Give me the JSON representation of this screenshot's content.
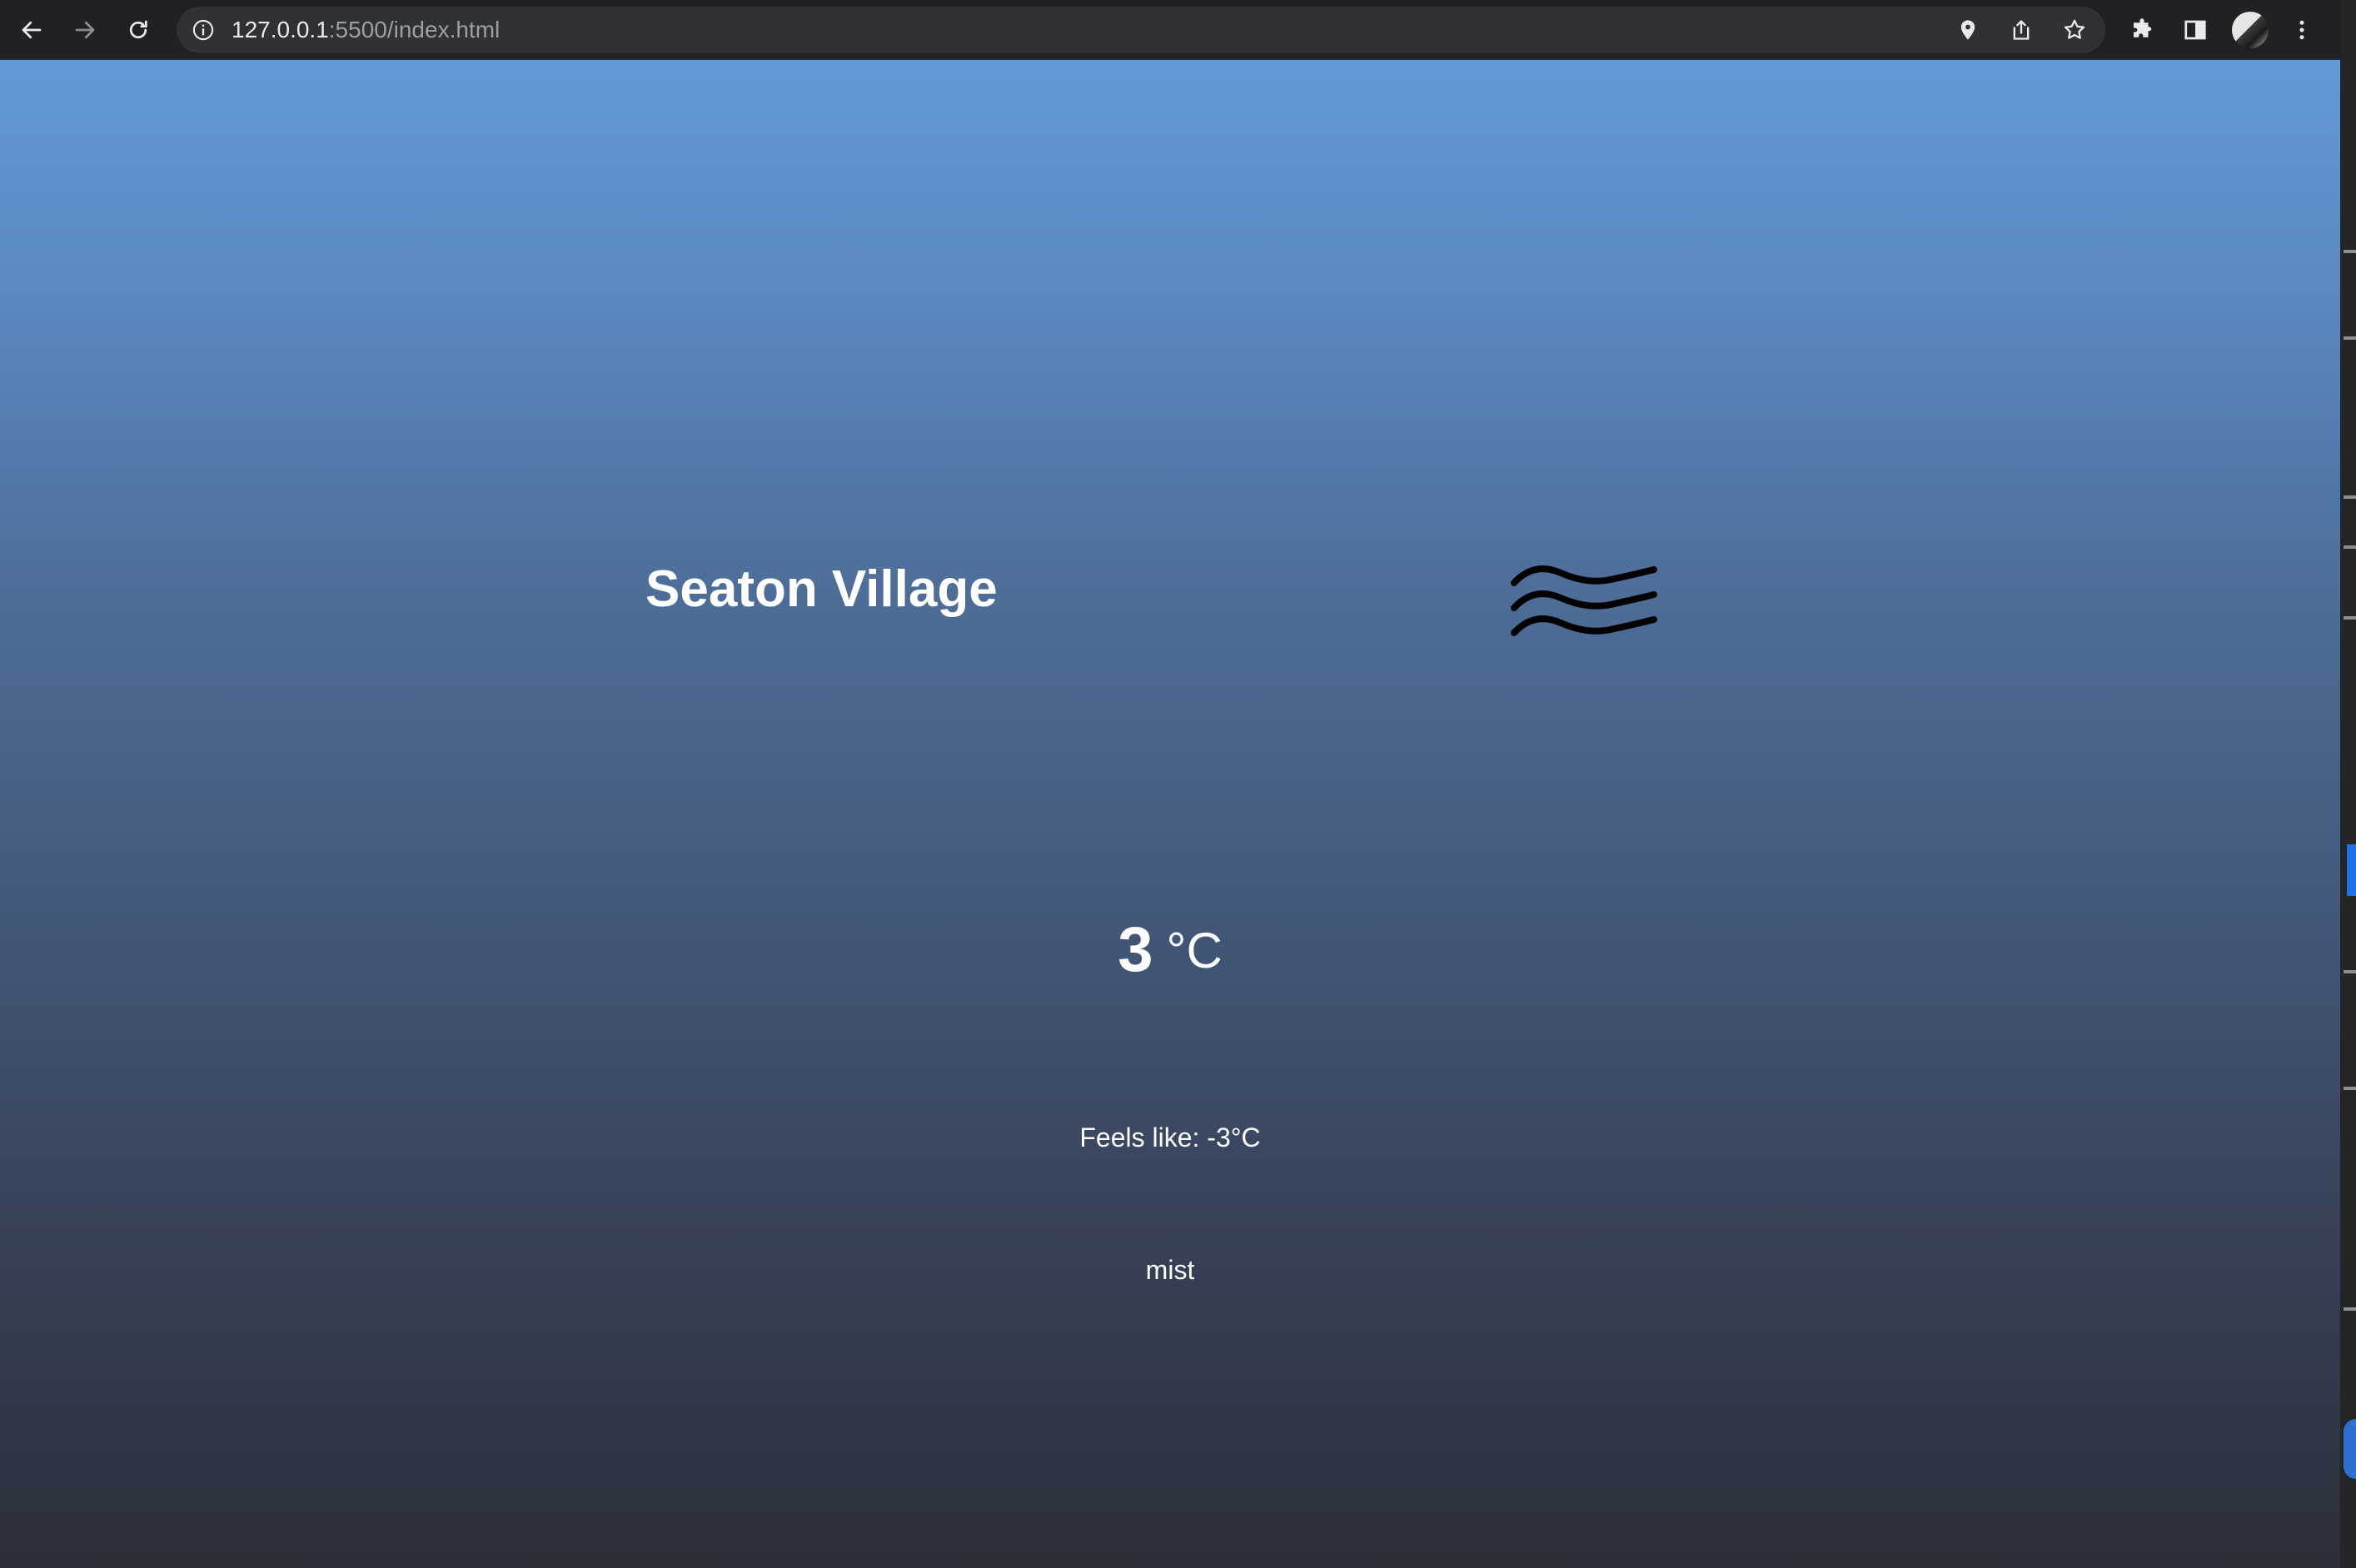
{
  "browser": {
    "url_host": "127.0.0.1",
    "url_rest": ":5500/index.html",
    "icons": {
      "back": "back-arrow-icon",
      "forward": "forward-arrow-icon",
      "reload": "reload-icon",
      "site_info": "info-icon",
      "location": "location-pin-icon",
      "share": "share-icon",
      "bookmark": "star-icon",
      "extensions": "puzzle-icon",
      "side_panel": "side-panel-icon",
      "profile": "avatar",
      "menu": "kebab-menu-icon"
    },
    "colors": {
      "toolbar": "#202124",
      "omnibox": "#303134"
    }
  },
  "weather": {
    "city": "Seaton Village",
    "temperature": "3",
    "unit": "°C",
    "feels_like": "Feels like: -3°C",
    "description": "mist",
    "icon": "mist-icon"
  },
  "theme": {
    "gradient_top": "#6399d6",
    "gradient_bottom": "#2a2e37",
    "text": "#ffffff"
  }
}
